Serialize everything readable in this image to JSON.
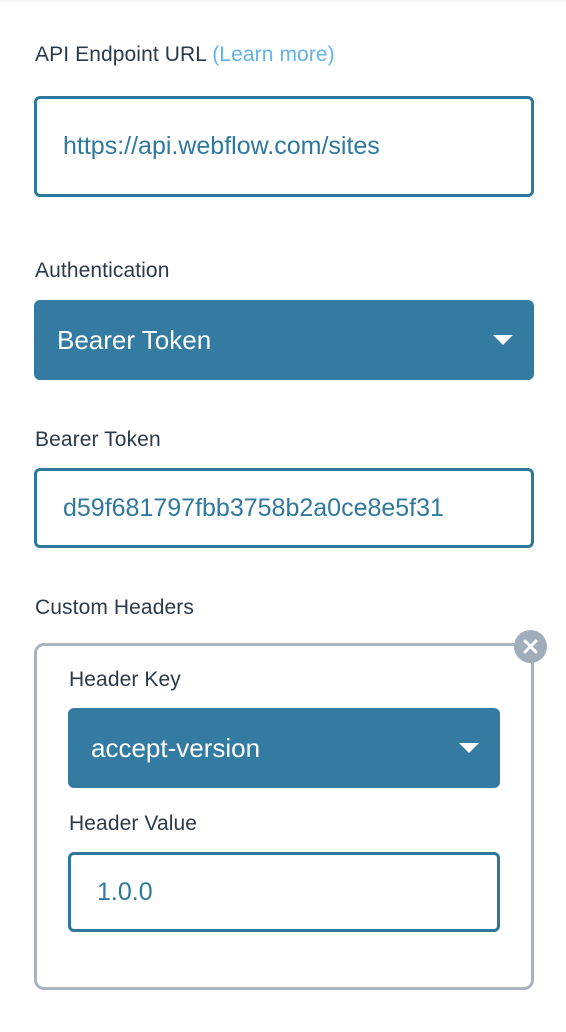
{
  "endpoint": {
    "label": "API Endpoint URL",
    "learn_more": "(Learn more)",
    "value": "https://api.webflow.com/sites"
  },
  "authentication": {
    "label": "Authentication",
    "selected": "Bearer Token"
  },
  "bearer_token": {
    "label": "Bearer Token",
    "value": "d59f681797fbb3758b2a0ce8e5f31"
  },
  "custom_headers": {
    "label": "Custom Headers",
    "items": [
      {
        "key_label": "Header Key",
        "key_selected": "accept-version",
        "value_label": "Header Value",
        "value": "1.0.0"
      }
    ]
  },
  "icons": {
    "dropdown": "chevron-down-icon",
    "remove": "close-circle-icon"
  },
  "colors": {
    "accent": "#347ba1",
    "link": "#63b3ed",
    "text": "#2b3a4a"
  }
}
